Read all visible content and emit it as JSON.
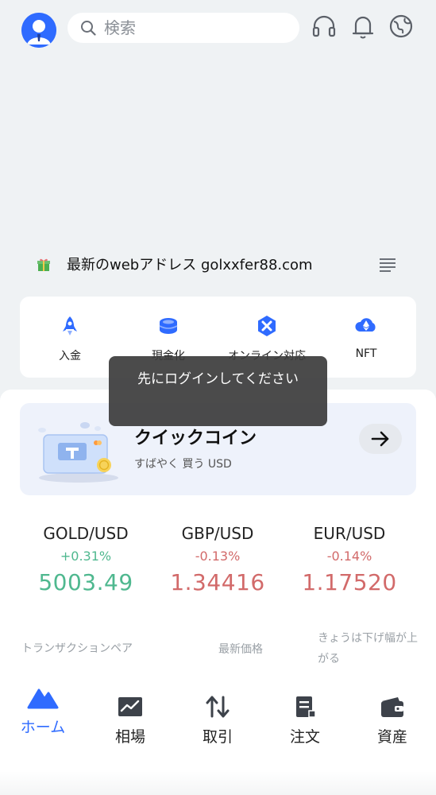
{
  "search": {
    "placeholder": "検索"
  },
  "notice": {
    "text": "最新のwebアドレス golxxfer88.com"
  },
  "quick_actions": [
    {
      "label": "入金",
      "icon": "rocket-icon"
    },
    {
      "label": "現金化",
      "icon": "coin-stack-icon"
    },
    {
      "label": "オンライン対応",
      "icon": "cross-hex-icon"
    },
    {
      "label": "NFT",
      "icon": "ethereum-cloud-icon"
    }
  ],
  "quick_coin": {
    "title": "クイックコイン",
    "subtitle": "すばやく 買う USD"
  },
  "tickers": [
    {
      "pair": "GOLD/USD",
      "change": "+0.31%",
      "price": "5003.49",
      "direction": "up"
    },
    {
      "pair": "GBP/USD",
      "change": "-0.13%",
      "price": "1.34416",
      "direction": "down"
    },
    {
      "pair": "EUR/USD",
      "change": "-0.14%",
      "price": "1.17520",
      "direction": "down"
    }
  ],
  "table_header": {
    "pair": "トランザクションペア",
    "price": "最新価格",
    "change": "きょうは下げ幅が上がる"
  },
  "tabs": [
    {
      "label": "ホーム",
      "icon": "mountain-icon",
      "active": true
    },
    {
      "label": "相場",
      "icon": "chart-icon",
      "active": false
    },
    {
      "label": "取引",
      "icon": "swap-arrows-icon",
      "active": false
    },
    {
      "label": "注文",
      "icon": "document-icon",
      "active": false
    },
    {
      "label": "資産",
      "icon": "wallet-icon",
      "active": false
    }
  ],
  "toast": {
    "text": "先にログインしてください"
  },
  "colors": {
    "accent": "#2f6bff",
    "up": "#4fb88f",
    "down": "#d26a6a"
  }
}
